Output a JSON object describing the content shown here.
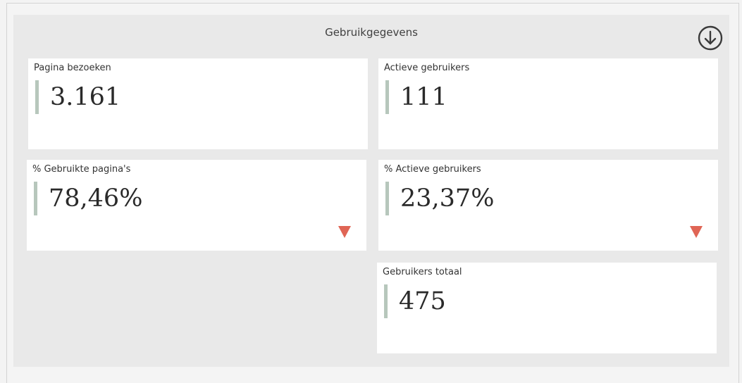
{
  "panel": {
    "title": "Gebruikgegevens",
    "download_icon": "arrow-down-circle-icon"
  },
  "cards": [
    {
      "label": "Pagina bezoeken",
      "value": "3.161",
      "trend": null
    },
    {
      "label": "Actieve gebruikers",
      "value": "111",
      "trend": null
    },
    {
      "label": "% Gebruikte pagina's",
      "value": "78,46%",
      "trend": "down"
    },
    {
      "label": "% Actieve gebruikers",
      "value": "23,37%",
      "trend": "down"
    },
    {
      "label": "Gebruikers totaal",
      "value": "475",
      "trend": null
    }
  ],
  "colors": {
    "accent_bar": "#b7c7bc",
    "trend_down": "#e06555",
    "panel_bg": "#e9e9e9",
    "card_bg": "#ffffff"
  }
}
